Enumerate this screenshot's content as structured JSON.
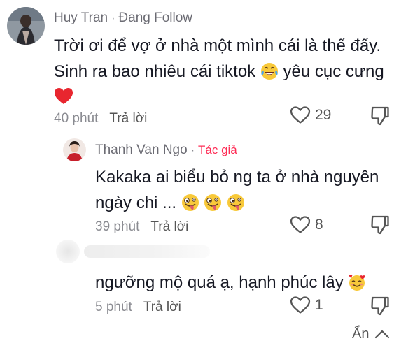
{
  "comments": [
    {
      "author": "Huy Tran",
      "status": "Đang Follow",
      "text_lines": [
        "Trời ơi để vợ ở nhà một mình cái là thế đấy.",
        "Sinh ra bao nhiêu cái tiktok",
        "yêu cục cưng"
      ],
      "time": "40 phút",
      "reply_label": "Trả lời",
      "likes": "29",
      "emojis": [
        "tears-of-joy-emoji",
        "red-heart-emoji"
      ]
    },
    {
      "author": "Thanh Van Ngo",
      "badge": "Tác giả",
      "text_lines": [
        "Kakaka ai biểu bỏ ng ta ở nhà nguyên",
        "ngày chi ..."
      ],
      "time": "39 phút",
      "reply_label": "Trả lời",
      "likes": "8",
      "emojis": [
        "zany-face-emoji",
        "zany-face-emoji",
        "zany-face-emoji"
      ]
    },
    {
      "author": "",
      "text_lines": [
        "ngưỡng mộ quá ạ, hạnh phúc lây"
      ],
      "time": "5 phút",
      "reply_label": "Trả lời",
      "likes": "1",
      "emojis": [
        "smiling-face-with-hearts-emoji"
      ]
    }
  ],
  "separator": "·",
  "hide_label": "Ẩn",
  "colors": {
    "accent": "#fe2c55",
    "muted": "#8a8b91",
    "text": "#161823"
  }
}
